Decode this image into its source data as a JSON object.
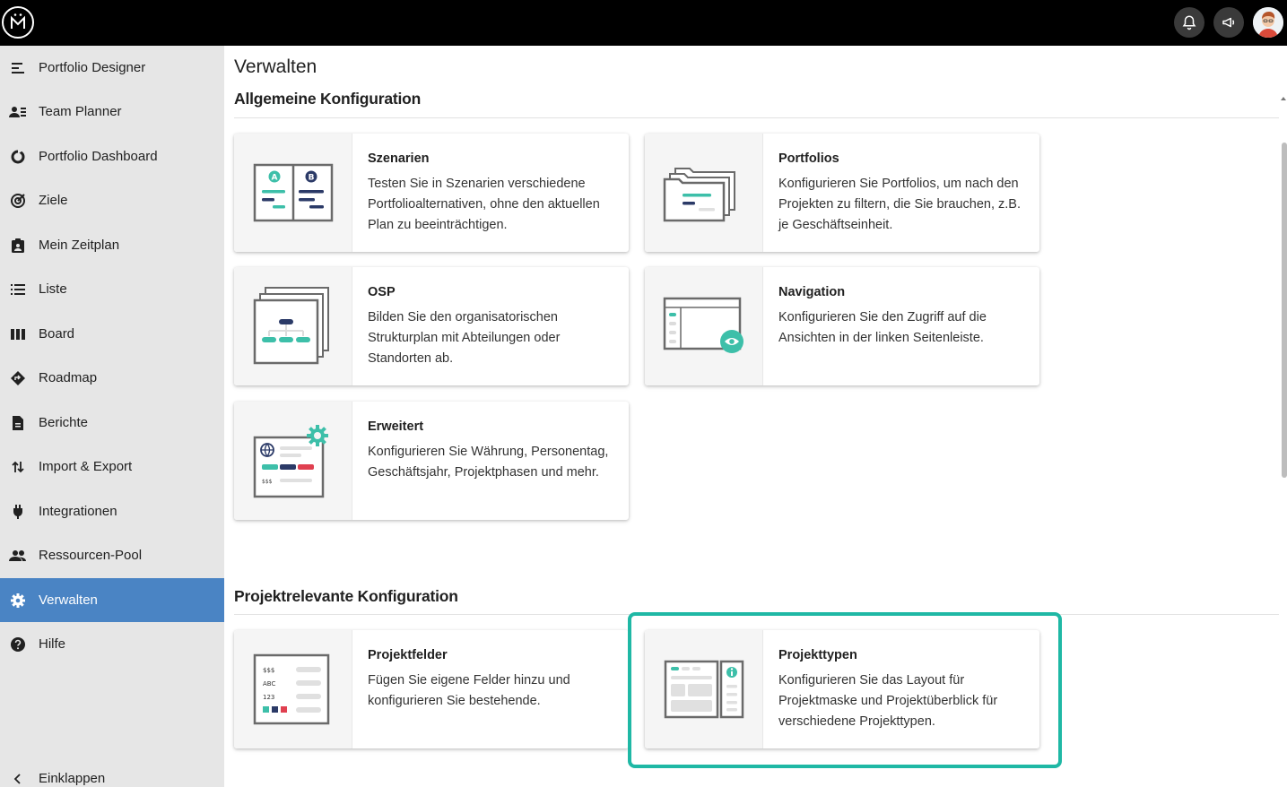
{
  "topbar": {
    "icons": [
      "app-logo-icon",
      "bell-icon",
      "megaphone-icon",
      "user-avatar"
    ]
  },
  "sidebar": {
    "items": [
      {
        "label": "Portfolio Designer",
        "icon": "portfolio-designer-icon"
      },
      {
        "label": "Team Planner",
        "icon": "team-planner-icon"
      },
      {
        "label": "Portfolio Dashboard",
        "icon": "dashboard-icon"
      },
      {
        "label": "Ziele",
        "icon": "target-icon"
      },
      {
        "label": "Mein Zeitplan",
        "icon": "my-schedule-icon"
      },
      {
        "label": "Liste",
        "icon": "list-icon"
      },
      {
        "label": "Board",
        "icon": "board-icon"
      },
      {
        "label": "Roadmap",
        "icon": "roadmap-icon"
      },
      {
        "label": "Berichte",
        "icon": "report-icon"
      },
      {
        "label": "Import & Export",
        "icon": "import-export-icon"
      },
      {
        "label": "Integrationen",
        "icon": "plug-icon"
      },
      {
        "label": "Ressourcen-Pool",
        "icon": "people-icon"
      },
      {
        "label": "Verwalten",
        "icon": "gear-icon",
        "active": true
      },
      {
        "label": "Hilfe",
        "icon": "help-icon"
      }
    ],
    "collapse_label": "Einklappen"
  },
  "main": {
    "title": "Verwalten",
    "sections": [
      {
        "title": "Allgemeine Konfiguration",
        "cards": [
          {
            "title": "Szenarien",
            "description": "Testen Sie in Szenarien verschiedene Portfolioalternativen, ohne den aktuellen Plan zu beeinträchtigen."
          },
          {
            "title": "Portfolios",
            "description": "Konfigurieren Sie Portfolios, um nach den Projekten zu filtern, die Sie brauchen, z.B. je Geschäftseinheit."
          },
          {
            "title": "OSP",
            "description": "Bilden Sie den organisatorischen Strukturplan mit Abteilungen oder Standorten ab."
          },
          {
            "title": "Navigation",
            "description": "Konfigurieren Sie den Zugriff auf die Ansichten in der linken Seitenleiste."
          },
          {
            "title": "Erweitert",
            "description": "Konfigurieren Sie Währung, Personentag, Geschäftsjahr, Projektphasen und mehr."
          }
        ]
      },
      {
        "title": "Projektrelevante Konfiguration",
        "cards": [
          {
            "title": "Projektfelder",
            "description": "Fügen Sie eigene Felder hinzu und konfigurieren Sie bestehende."
          },
          {
            "title": "Projekttypen",
            "description": "Konfigurieren Sie das Layout für Projektmaske und Projektüberblick für verschiedene Projekttypen."
          }
        ]
      }
    ],
    "illustration_text": {
      "scenario_a": "A",
      "scenario_b": "B",
      "field_currency": "$$$",
      "field_abc": "ABC",
      "field_num": "123"
    }
  },
  "colors": {
    "accent_teal": "#3dbfa9",
    "navy": "#2b3a67",
    "red": "#e04050",
    "active_nav": "#4a84c4",
    "highlight": "#1fb8a5"
  }
}
